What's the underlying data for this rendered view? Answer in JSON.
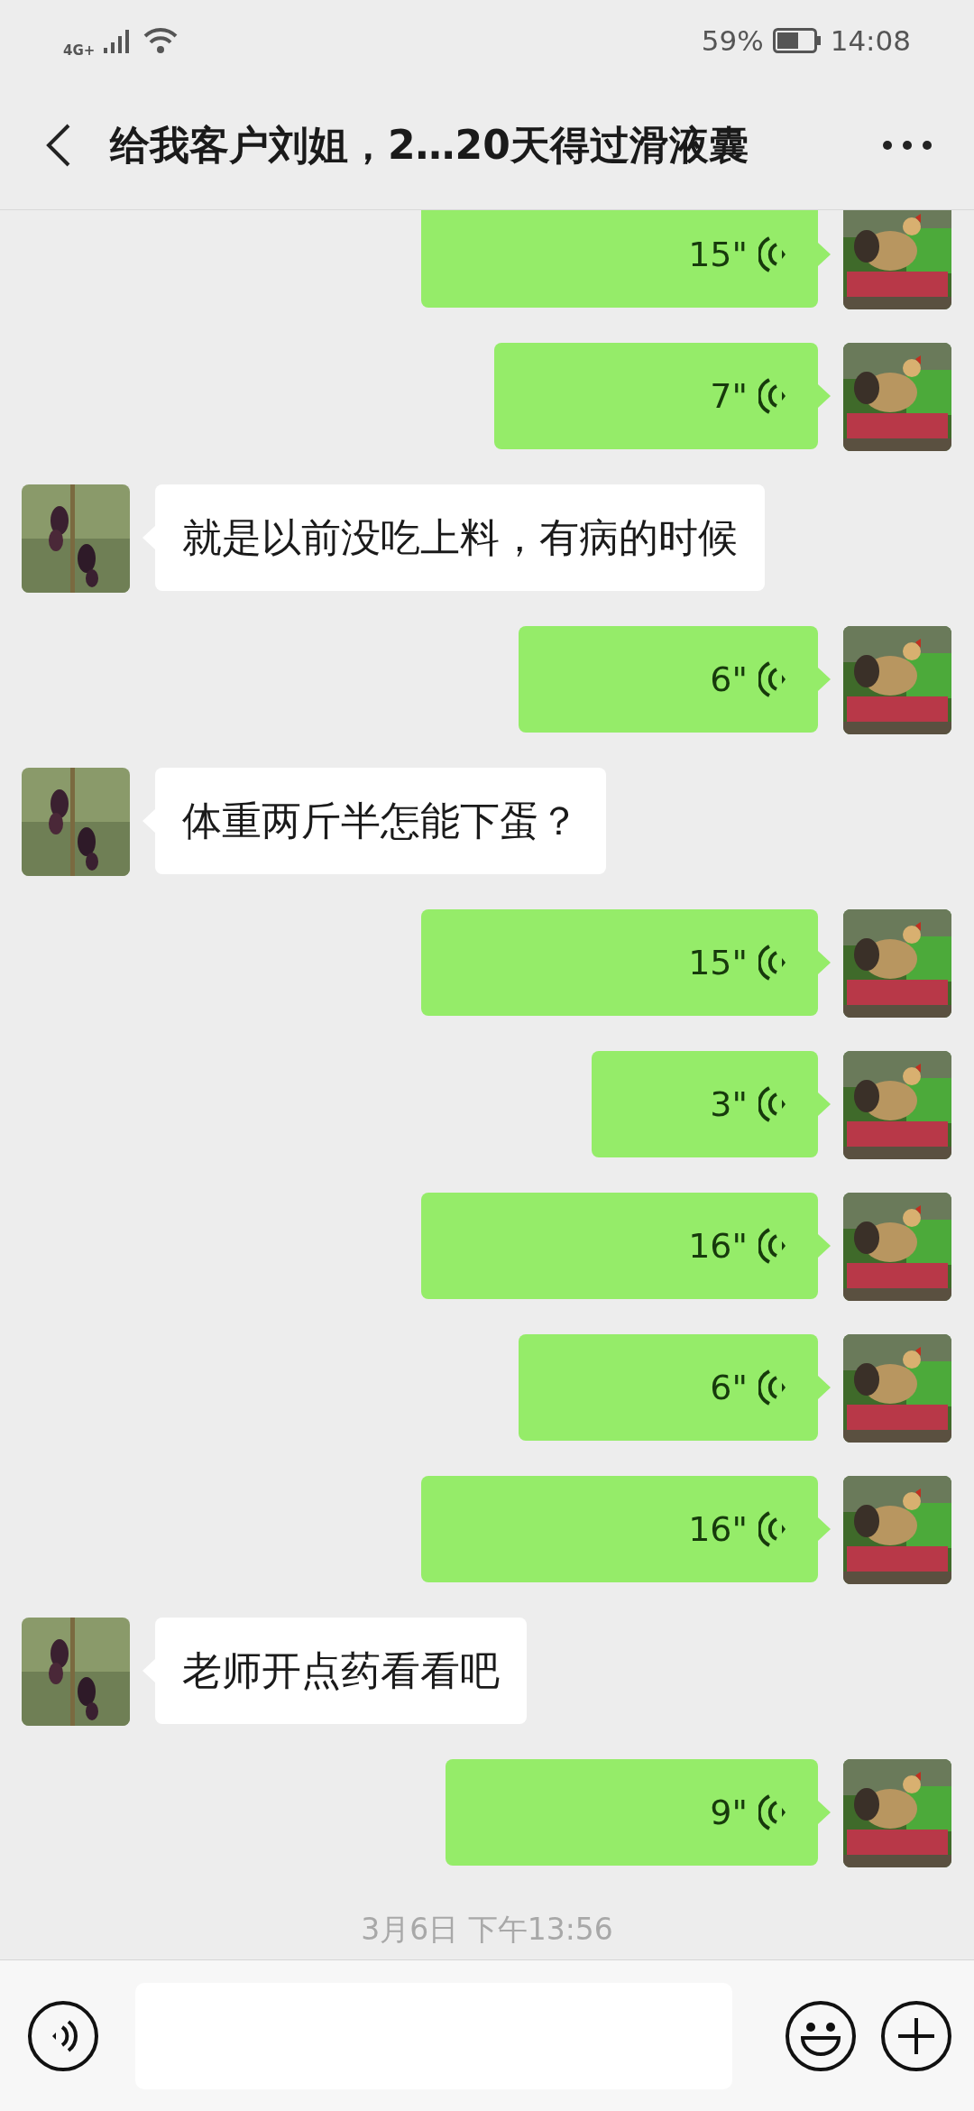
{
  "status_bar": {
    "network": "4G+",
    "battery": "59%",
    "time": "14:08"
  },
  "header": {
    "title": "给我客户刘姐，2…20天得过滑液囊"
  },
  "messages": [
    {
      "kind": "voice",
      "outgoing": true,
      "duration": "15\""
    },
    {
      "kind": "voice",
      "outgoing": true,
      "duration": "7\""
    },
    {
      "kind": "text",
      "outgoing": false,
      "text": "就是以前没吃上料，有病的时候"
    },
    {
      "kind": "voice",
      "outgoing": true,
      "duration": "6\""
    },
    {
      "kind": "text",
      "outgoing": false,
      "text": "体重两斤半怎能下蛋？"
    },
    {
      "kind": "voice",
      "outgoing": true,
      "duration": "15\""
    },
    {
      "kind": "voice",
      "outgoing": true,
      "duration": "3\""
    },
    {
      "kind": "voice",
      "outgoing": true,
      "duration": "16\""
    },
    {
      "kind": "voice",
      "outgoing": true,
      "duration": "6\""
    },
    {
      "kind": "voice",
      "outgoing": true,
      "duration": "16\""
    },
    {
      "kind": "text",
      "outgoing": false,
      "text": "老师开点药看看吧"
    },
    {
      "kind": "voice",
      "outgoing": true,
      "duration": "9\""
    }
  ],
  "timestamp": "3月6日 下午13:56"
}
